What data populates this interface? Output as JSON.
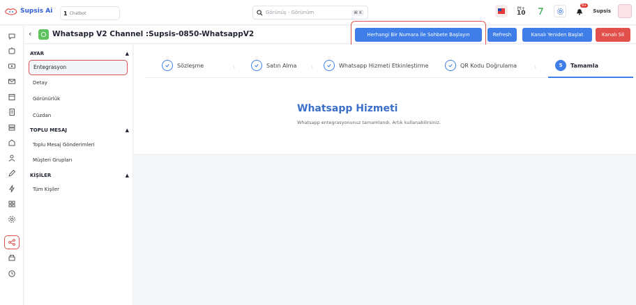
{
  "app": {
    "name": "Supsis Ai"
  },
  "chatbot_tab": {
    "count": "1",
    "label": "Chatbot"
  },
  "search": {
    "placeholder": "Görünüş - Görünüm",
    "shortcut": "⌘ K"
  },
  "topbar": {
    "points_label": "Pt",
    "points_value": "10",
    "notification_count": "9+",
    "username": "Supsis"
  },
  "channel": {
    "title": "Whatsapp V2 Channel :Supsis-0850-WhatsappV2",
    "buttons": {
      "start_chat": "Herhangi Bir Numara İle Sohbete Başlayın",
      "refresh": "Refresh",
      "restart": "Kanalı Yeniden Başlat",
      "delete": "Kanalı Sil"
    }
  },
  "menu": {
    "sections": [
      {
        "title": "AYAR",
        "items": [
          "Entegrasyon",
          "Detay",
          "Görünürlük",
          "Cüzdan"
        ]
      },
      {
        "title": "TOPLU MESAJ",
        "items": [
          "Toplu Mesaj Gönderimleri",
          "Müşteri Grupları"
        ]
      },
      {
        "title": "KİŞİLER",
        "items": [
          "Tüm Kişiler"
        ]
      }
    ],
    "active_item": "Entegrasyon"
  },
  "steps": [
    {
      "label": "Sözleşme",
      "state": "done"
    },
    {
      "label": "Satın Alma",
      "state": "done"
    },
    {
      "label": "Whatsapp Hizmeti Etkinleştirme",
      "state": "done"
    },
    {
      "label": "QR Kodu Doğrulama",
      "state": "done"
    },
    {
      "label": "Tamamla",
      "state": "current",
      "number": "5"
    }
  ],
  "result": {
    "title": "Whatsapp Hizmeti",
    "description": "Whatsapp entegrasyonunuz tamamlandı. Artık kullanabilirsiniz."
  },
  "colors": {
    "primary": "#3f7ee8",
    "danger": "#e2504c",
    "highlight": "#d9534f"
  }
}
